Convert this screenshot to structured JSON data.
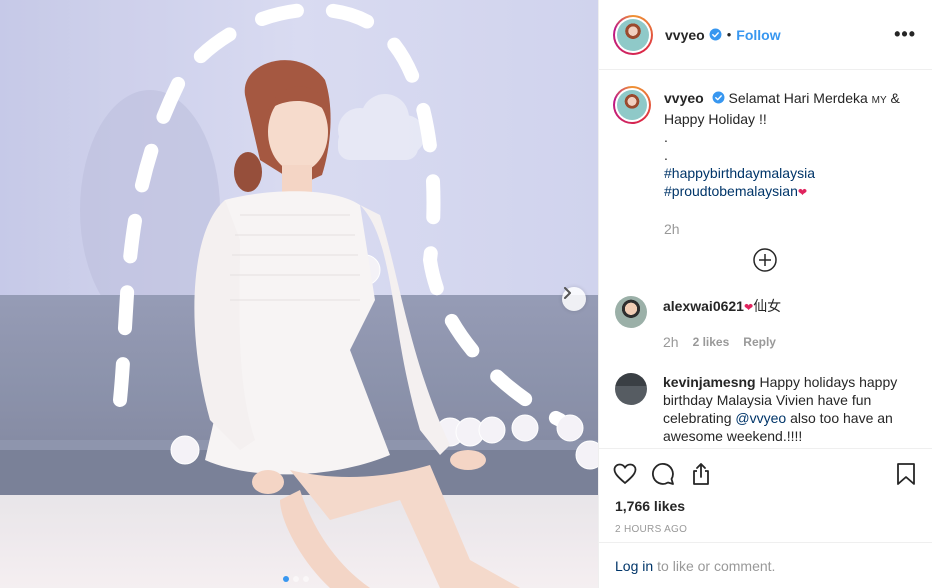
{
  "post": {
    "username": "vvyeo",
    "follow_label": "Follow",
    "more_label": "•••",
    "caption": {
      "username": "vvyeo",
      "line1_pre": "Selamat Hari Merdeka ",
      "line1_flag": "MY",
      "line1_post": " &",
      "line2": "Happy Holiday !!",
      "dot1": ".",
      "dot2": ".",
      "hashtag1": "#happybirthdaymalaysia",
      "hashtag2": "#proudtobemalaysian",
      "time": "2h"
    },
    "comments": [
      {
        "username": "alexwai0621",
        "text": "仙女",
        "time": "2h",
        "likes": "2 likes",
        "reply": "Reply"
      },
      {
        "username": "kevinjamesng",
        "text_pre": "Happy holidays happy birthday Malaysia Vivien have fun celebrating ",
        "mention": "@vvyeo",
        "text_post": " also too have an awesome weekend.!!!!"
      }
    ],
    "likes": "1,766 likes",
    "posted_ago": "2 HOURS AGO",
    "login_link": "Log in",
    "login_text": "to like or comment.",
    "carousel": {
      "slides": 3,
      "active_index": 0
    }
  },
  "icons": {
    "verified": "verified-badge-icon",
    "like": "heart-icon",
    "comment": "comment-icon",
    "share": "share-icon",
    "save": "bookmark-icon",
    "load_more": "plus-circle-icon",
    "carousel_next": "chevron-right-icon"
  },
  "colors": {
    "link_blue": "#3897f0",
    "hashtag": "#003569",
    "muted": "#999999",
    "text": "#262626",
    "carousel_active": "#3897f0"
  }
}
